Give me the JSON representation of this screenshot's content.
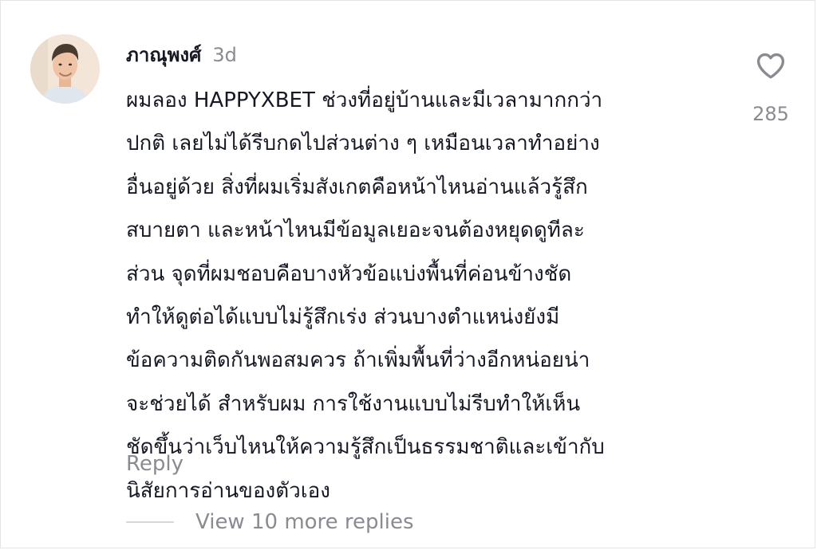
{
  "comment": {
    "username": "ภาณุพงศ์",
    "timestamp": "3d",
    "lines": [
      "ผมลอง HAPPYXBET ช่วงที่อยู่บ้านและมีเวลามากกว่า",
      "ปกติ เลยไม่ได้รีบกดไปส่วนต่าง ๆ เหมือนเวลาทำอย่าง",
      "อื่นอยู่ด้วย สิ่งที่ผมเริ่มสังเกตคือหน้าไหนอ่านแล้วรู้สึก",
      "สบายตา และหน้าไหนมีข้อมูลเยอะจนต้องหยุดดูทีละ",
      "ส่วน จุดที่ผมชอบคือบางหัวข้อแบ่งพื้นที่ค่อนข้างชัด",
      "ทำให้ดูต่อได้แบบไม่รู้สึกเร่ง ส่วนบางตำแหน่งยังมี",
      "ข้อความติดกันพอสมควร ถ้าเพิ่มพื้นที่ว่างอีกหน่อยน่า",
      "จะช่วยได้ สำหรับผม การใช้งานแบบไม่รีบทำให้เห็น",
      "ชัดขึ้นว่าเว็บไหนให้ความรู้สึกเป็นธรรมชาติและเข้ากับ",
      "นิสัยการอ่านของตัวเอง"
    ],
    "reply_label": "Reply",
    "more_replies_label": "View 10 more replies",
    "like_count": "285",
    "like_icon": "heart-outline-icon"
  },
  "colors": {
    "text_primary": "#161823",
    "text_secondary": "#8a8b91",
    "divider": "#d7d7da",
    "border": "#e4e4e4"
  }
}
